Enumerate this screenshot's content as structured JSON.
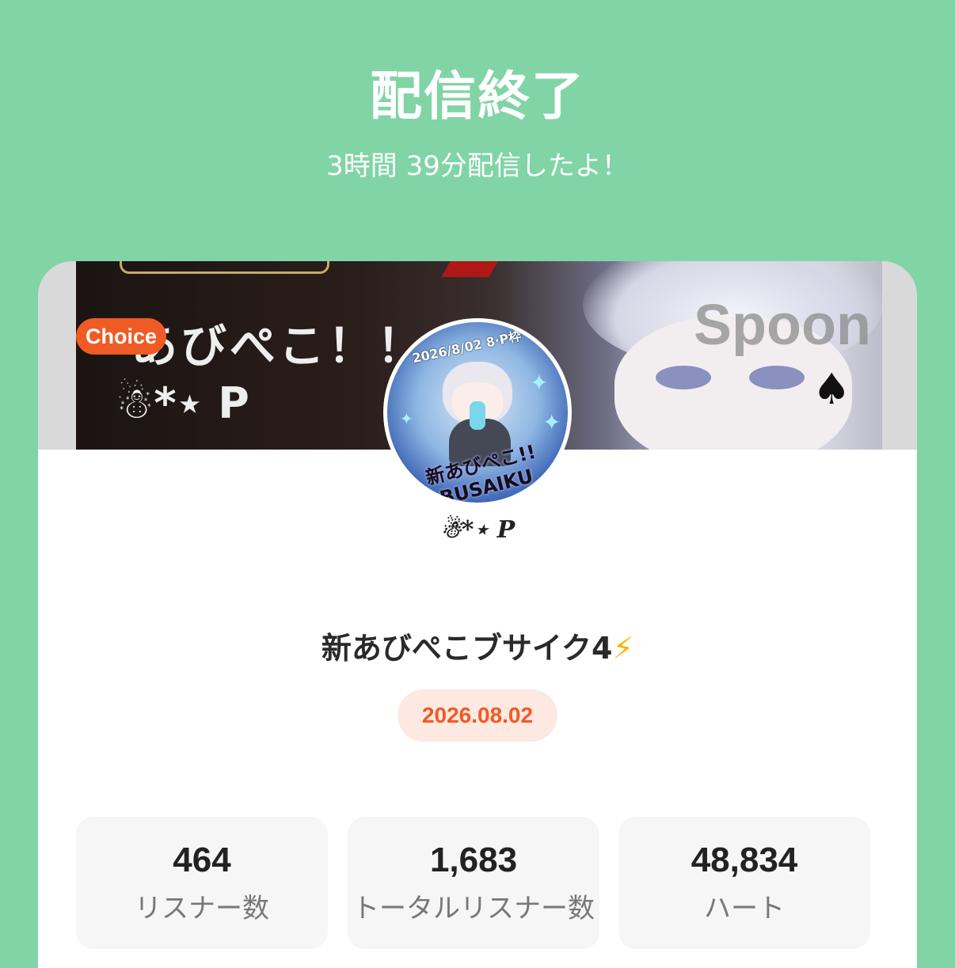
{
  "header": {
    "title": "配信終了",
    "subtitle": "3時間 39分配信したよ！"
  },
  "cover": {
    "badge": "Choice",
    "text_line1": "あびぺこ！！",
    "text_line2": "☃*⋆ P",
    "logo": "Spoon"
  },
  "avatar": {
    "top_text": "2026/8/02 8·P枠",
    "art_text": "新あびぺこ!! BUSAIKU"
  },
  "profile": {
    "username": "☃*⋆ P"
  },
  "broadcast": {
    "title": "新あびぺこブサイク4",
    "title_emoji": "⚡",
    "date": "2026.08.02"
  },
  "stats": [
    {
      "value": "464",
      "label": "リスナー数"
    },
    {
      "value": "1,683",
      "label": "トータルリスナー数"
    },
    {
      "value": "48,834",
      "label": "ハート"
    }
  ],
  "colors": {
    "background": "#81d4a6",
    "choice_badge": "#f05a24",
    "date_text": "#f15a24",
    "date_bg": "#fde9e2",
    "bolt": "#f6b400"
  },
  "icons": [
    "lightning-bolt-icon",
    "snowman-icon",
    "spade-icon",
    "sparkle-icon"
  ]
}
